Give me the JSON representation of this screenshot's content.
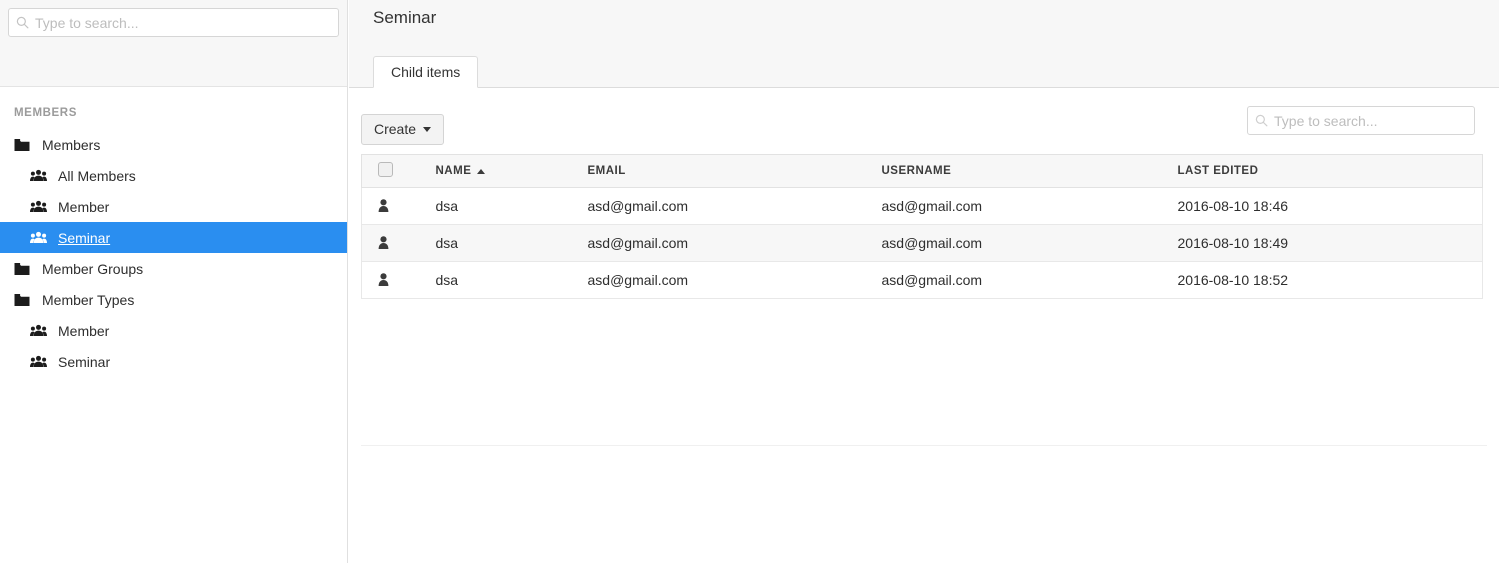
{
  "sidebar": {
    "search": {
      "placeholder": "Type to search...",
      "value": "",
      "icon": "search-icon"
    },
    "section_title": "MEMBERS",
    "items": [
      {
        "label": "Members",
        "icon": "folder-icon",
        "level": 1,
        "selected": false
      },
      {
        "label": "All Members",
        "icon": "members-group-icon",
        "level": 2,
        "selected": false
      },
      {
        "label": "Member",
        "icon": "members-group-icon",
        "level": 2,
        "selected": false
      },
      {
        "label": "Seminar",
        "icon": "members-group-icon",
        "level": 2,
        "selected": true
      },
      {
        "label": "Member Groups",
        "icon": "folder-icon",
        "level": 1,
        "selected": false
      },
      {
        "label": "Member Types",
        "icon": "folder-icon",
        "level": 1,
        "selected": false
      },
      {
        "label": "Member",
        "icon": "members-group-icon",
        "level": 2,
        "selected": false
      },
      {
        "label": "Seminar",
        "icon": "members-group-icon",
        "level": 2,
        "selected": false
      }
    ]
  },
  "main": {
    "title": "Seminar",
    "tabs": [
      {
        "label": "Child items",
        "active": true
      }
    ],
    "toolbar": {
      "create_label": "Create",
      "create_caret": "caret-down-icon",
      "search": {
        "placeholder": "Type to search...",
        "value": "",
        "icon": "search-icon"
      }
    },
    "table": {
      "select_all_checked": false,
      "sort_column": "NAME",
      "sort_direction": "ascending",
      "columns": [
        "NAME",
        "EMAIL",
        "USERNAME",
        "LAST EDITED"
      ],
      "rows": [
        {
          "icon": "member-person-icon",
          "name": "dsa",
          "email": "asd@gmail.com",
          "username": "asd@gmail.com",
          "last_edited": "2016-08-10 18:46"
        },
        {
          "icon": "member-person-icon",
          "name": "dsa",
          "email": "asd@gmail.com",
          "username": "asd@gmail.com",
          "last_edited": "2016-08-10 18:49"
        },
        {
          "icon": "member-person-icon",
          "name": "dsa",
          "email": "asd@gmail.com",
          "username": "asd@gmail.com",
          "last_edited": "2016-08-10 18:52"
        }
      ]
    }
  },
  "colors": {
    "selection_blue": "#2a8ef0",
    "panel_gray": "#f7f7f7",
    "border_gray": "#e2e2e2",
    "text_dark": "#2e2e2e"
  }
}
